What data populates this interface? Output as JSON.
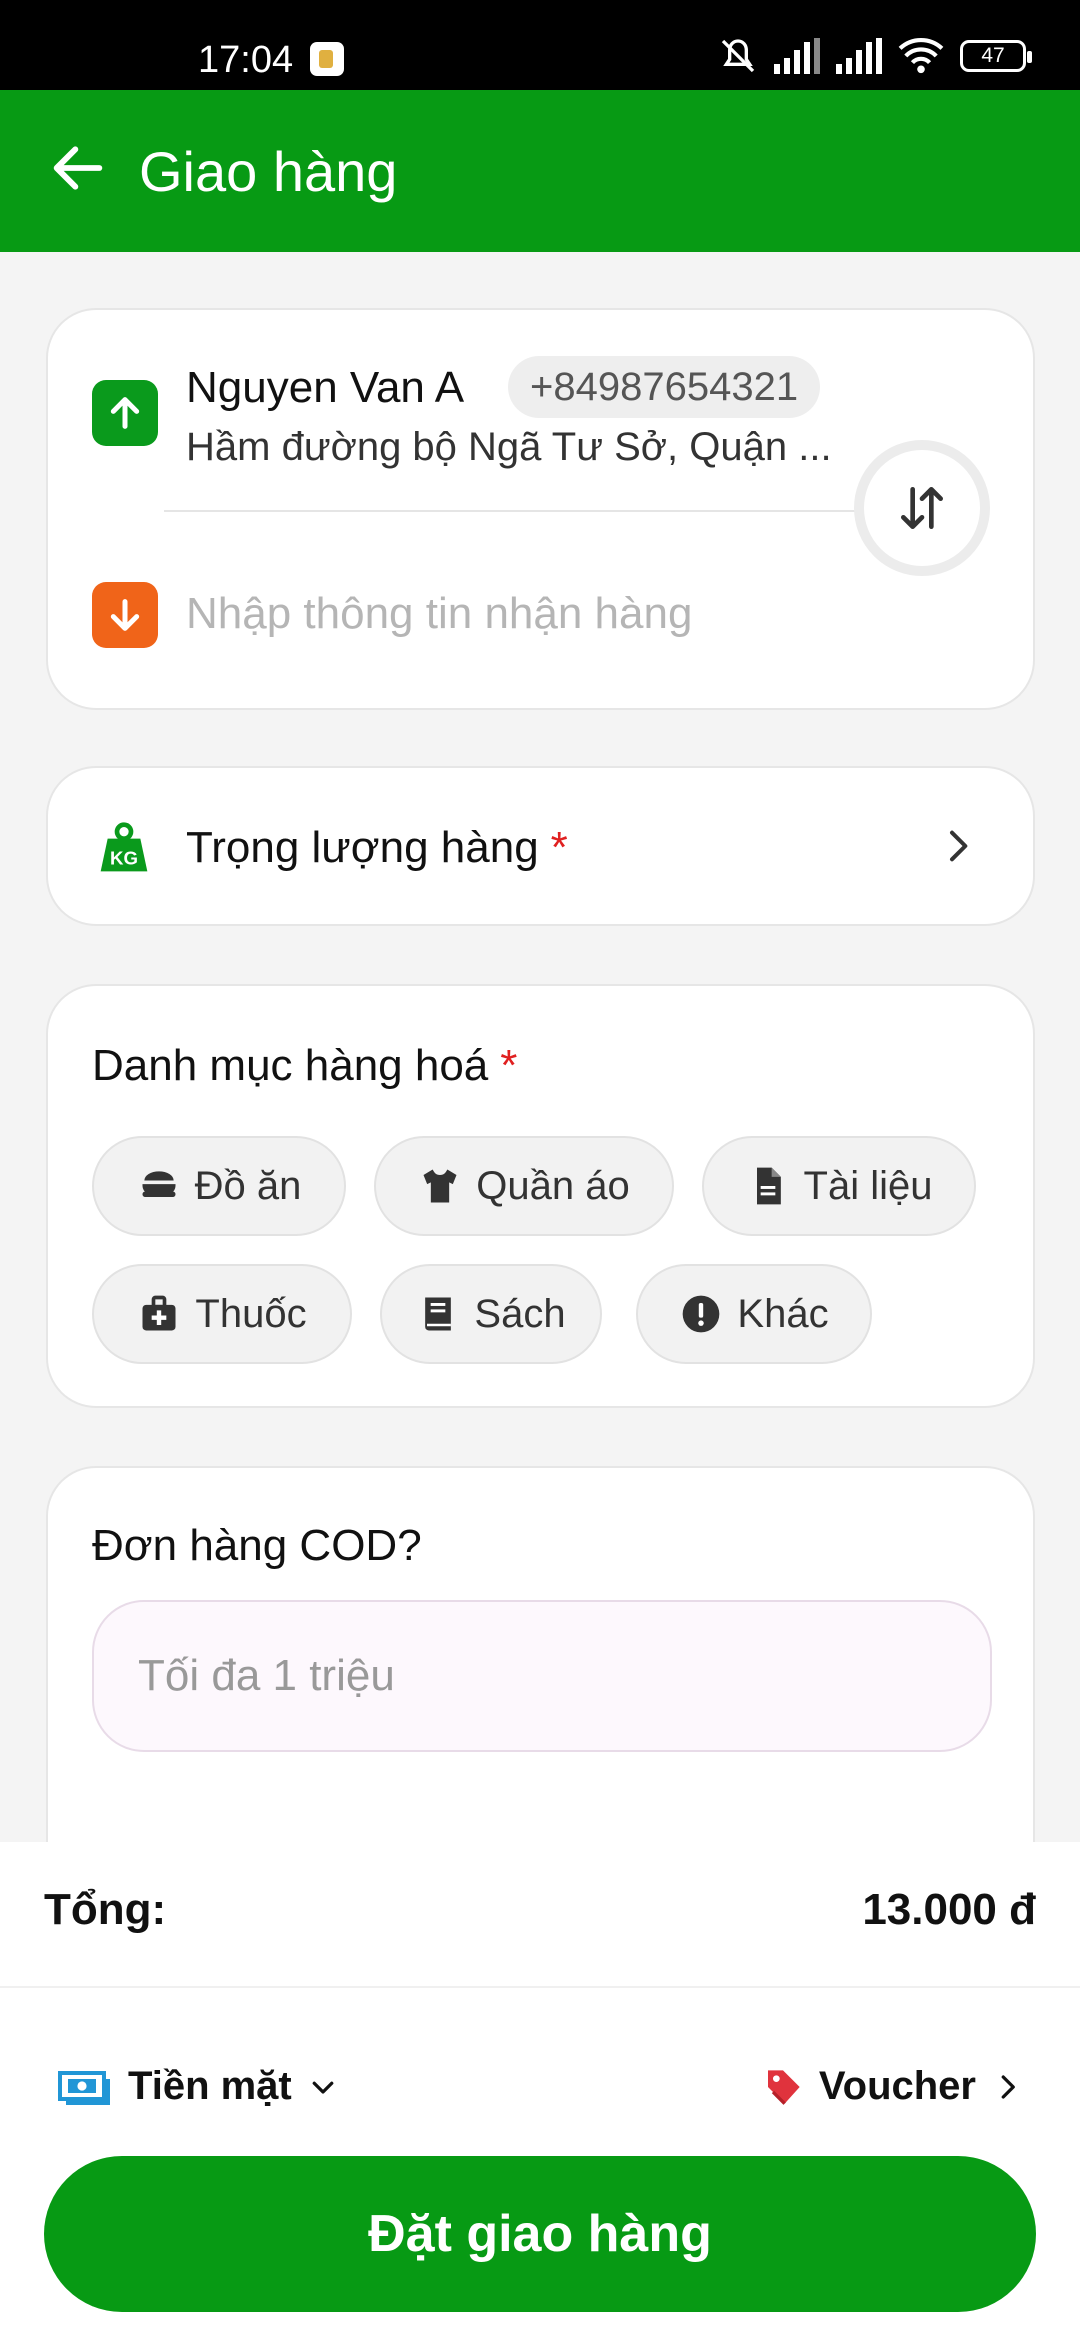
{
  "status_bar": {
    "time": "17:04",
    "battery": "47"
  },
  "header": {
    "title": "Giao hàng"
  },
  "route": {
    "sender_name": "Nguyen Van A",
    "sender_phone": "+84987654321",
    "sender_address": "Hầm đường bộ Ngã Tư Sở, Quận ...",
    "receiver_placeholder": "Nhập thông tin nhận hàng"
  },
  "weight": {
    "label": "Trọng lượng hàng",
    "required_mark": "*"
  },
  "category": {
    "title": "Danh mục hàng hoá",
    "required_mark": "*",
    "items": [
      {
        "label": "Đồ ăn",
        "icon": "food-bowl-icon"
      },
      {
        "label": "Quần áo",
        "icon": "shirt-icon"
      },
      {
        "label": "Tài liệu",
        "icon": "document-icon"
      },
      {
        "label": "Thuốc",
        "icon": "medical-kit-icon"
      },
      {
        "label": "Sách",
        "icon": "book-icon"
      },
      {
        "label": "Khác",
        "icon": "info-icon"
      }
    ]
  },
  "cod": {
    "title": "Đơn hàng COD?",
    "placeholder": "Tối đa 1 triệu",
    "value": ""
  },
  "summary": {
    "total_label": "Tổng:",
    "total_value": "13.000 đ"
  },
  "payment": {
    "method": "Tiền mặt",
    "voucher_label": "Voucher"
  },
  "cta": {
    "label": "Đặt giao hàng"
  },
  "colors": {
    "brand_green": "#079a14",
    "pickup_orange": "#f06419",
    "required_red": "#e02020",
    "voucher_red": "#e0333d",
    "cash_blue": "#2196d6"
  }
}
